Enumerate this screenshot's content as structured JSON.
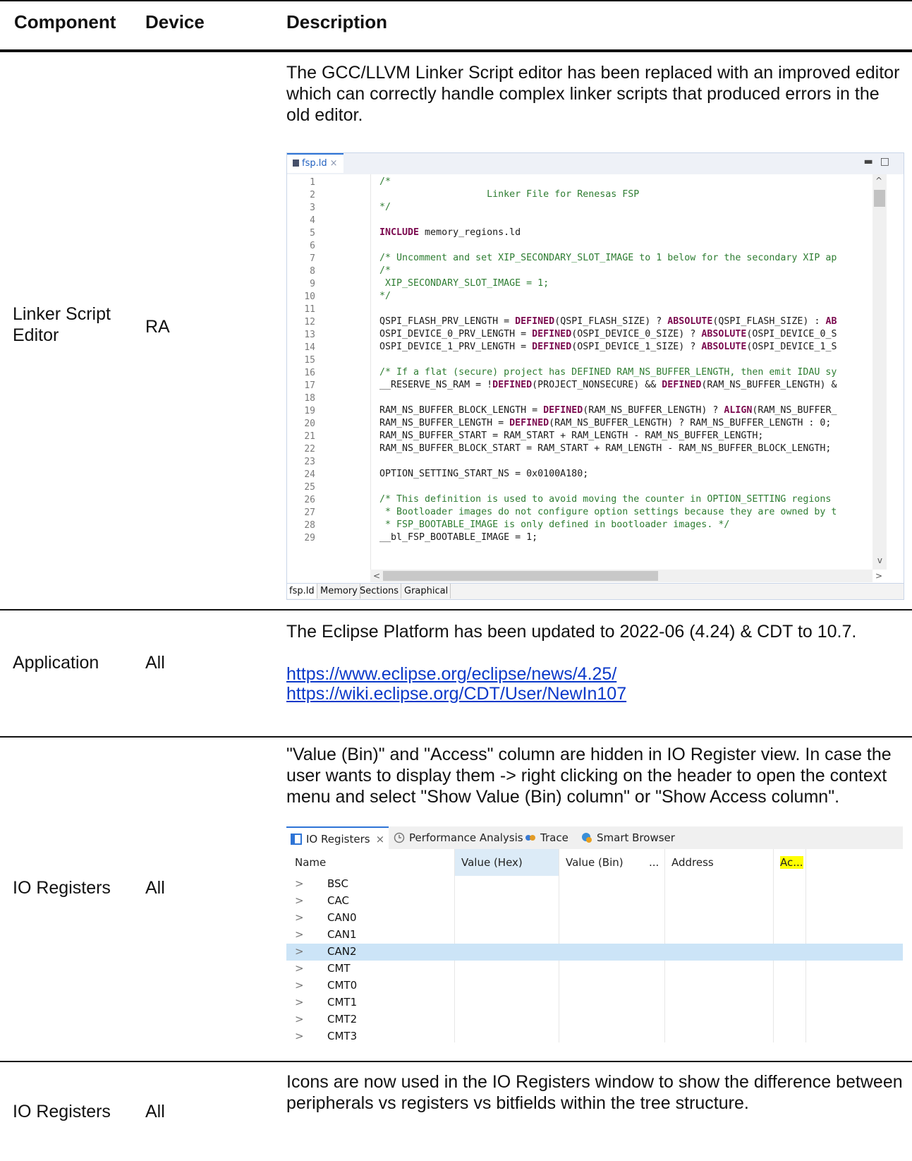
{
  "header": {
    "component": "Component",
    "device": "Device",
    "description": "Description"
  },
  "rows": [
    {
      "component": "Linker Script Editor",
      "device": "RA",
      "description": "The GCC/LLVM Linker Script editor has been replaced with an improved editor which can correctly handle complex linker scripts that produced errors in the old editor."
    },
    {
      "component": "Application",
      "device": "All",
      "description": "The Eclipse Platform has been updated to 2022-06 (4.24) & CDT to 10.7.",
      "links": [
        "https://www.eclipse.org/eclipse/news/4.25/",
        "https://wiki.eclipse.org/CDT/User/NewIn107"
      ]
    },
    {
      "component": "IO Registers",
      "device": "All",
      "description": "\"Value (Bin)\" and \"Access\" column are hidden in IO Register view. In case the user wants to display them -> right clicking on the header to open the context menu and select \"Show Value (Bin) column\" or \"Show Access column\"."
    },
    {
      "component": "IO Registers",
      "device": "All",
      "description": "Icons are now used in the IO Registers window to show the difference between peripherals vs registers vs bitfields within the tree structure."
    }
  ],
  "editor": {
    "tab": "fsp.ld",
    "bottom_tabs": [
      "fsp.ld",
      "Memory",
      "Sections",
      "Graphical"
    ],
    "line_numbers": [
      "1",
      "2",
      "3",
      "4",
      "5",
      "6",
      "7",
      "8",
      "9",
      "10",
      "11",
      "12",
      "13",
      "14",
      "15",
      "16",
      "17",
      "18",
      "19",
      "20",
      "21",
      "22",
      "23",
      "24",
      "25",
      "26",
      "27",
      "28",
      "29"
    ],
    "l1": "/*",
    "l2": "                   Linker File for Renesas FSP",
    "l3": "*/",
    "l5a": "INCLUDE",
    "l5b": " memory_regions.ld",
    "l7": "/* Uncomment and set XIP_SECONDARY_SLOT_IMAGE to 1 below for the secondary XIP ap",
    "l8": "/*",
    "l9": " XIP_SECONDARY_SLOT_IMAGE = 1;",
    "l10": "*/",
    "l12a": "QSPI_FLASH_PRV_LENGTH = ",
    "l12b": "DEFINED",
    "l12c": "(QSPI_FLASH_SIZE) ? ",
    "l12d": "ABSOLUTE",
    "l12e": "(QSPI_FLASH_SIZE) : ",
    "l12f": "AB",
    "l13a": "OSPI_DEVICE_0_PRV_LENGTH = ",
    "l13b": "DEFINED",
    "l13c": "(OSPI_DEVICE_0_SIZE) ? ",
    "l13d": "ABSOLUTE",
    "l13e": "(OSPI_DEVICE_0_S",
    "l14a": "OSPI_DEVICE_1_PRV_LENGTH = ",
    "l14b": "DEFINED",
    "l14c": "(OSPI_DEVICE_1_SIZE) ? ",
    "l14d": "ABSOLUTE",
    "l14e": "(OSPI_DEVICE_1_S",
    "l16": "/* If a flat (secure) project has DEFINED RAM_NS_BUFFER_LENGTH, then emit IDAU sy",
    "l17a": "__RESERVE_NS_RAM = !",
    "l17b": "DEFINED",
    "l17c": "(PROJECT_NONSECURE) && ",
    "l17d": "DEFINED",
    "l17e": "(RAM_NS_BUFFER_LENGTH) &",
    "l19a": "RAM_NS_BUFFER_BLOCK_LENGTH = ",
    "l19b": "DEFINED",
    "l19c": "(RAM_NS_BUFFER_LENGTH) ? ",
    "l19d": "ALIGN",
    "l19e": "(RAM_NS_BUFFER_",
    "l20a": "RAM_NS_BUFFER_LENGTH = ",
    "l20b": "DEFINED",
    "l20c": "(RAM_NS_BUFFER_LENGTH) ? RAM_NS_BUFFER_LENGTH : 0;",
    "l21": "RAM_NS_BUFFER_START = RAM_START + RAM_LENGTH - RAM_NS_BUFFER_LENGTH;",
    "l22": "RAM_NS_BUFFER_BLOCK_START = RAM_START + RAM_LENGTH - RAM_NS_BUFFER_BLOCK_LENGTH;",
    "l24": "OPTION_SETTING_START_NS = 0x0100A180;",
    "l26": "/* This definition is used to avoid moving the counter in OPTION_SETTING regions ",
    "l27": " * Bootloader images do not configure option settings because they are owned by t",
    "l28": " * FSP_BOOTABLE_IMAGE is only defined in bootloader images. */",
    "l29": "__bl_FSP_BOOTABLE_IMAGE = 1;"
  },
  "io_registers": {
    "tabs": [
      "IO Registers",
      "Performance Analysis",
      "Trace",
      "Smart Browser"
    ],
    "columns": [
      "Name",
      "Value (Hex)",
      "Value (Bin)",
      "...",
      "Address",
      "Ac..."
    ],
    "items": [
      "BSC",
      "CAC",
      "CAN0",
      "CAN1",
      "CAN2",
      "CMT",
      "CMT0",
      "CMT1",
      "CMT2",
      "CMT3"
    ],
    "selected": "CAN2",
    "highlight_color": "#ffff00",
    "accent_color": "#2e74d6"
  }
}
